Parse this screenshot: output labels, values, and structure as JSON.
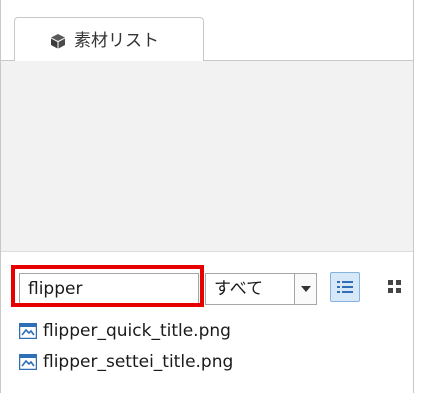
{
  "tab": {
    "label": "素材リスト",
    "icon": "cube-icon"
  },
  "search": {
    "value": "flipper"
  },
  "filter": {
    "selected": "すべて"
  },
  "view": {
    "list_icon": "list-view-icon",
    "grid_icon": "grid-view-icon",
    "active": "list"
  },
  "files": [
    {
      "name": "flipper_quick_title.png",
      "icon": "image-file-icon"
    },
    {
      "name": "flipper_settei_title.png",
      "icon": "image-file-icon"
    }
  ],
  "colors": {
    "highlight": "#e60000",
    "file_icon": "#2f6fb8",
    "active_view": "#d7e8f8"
  }
}
